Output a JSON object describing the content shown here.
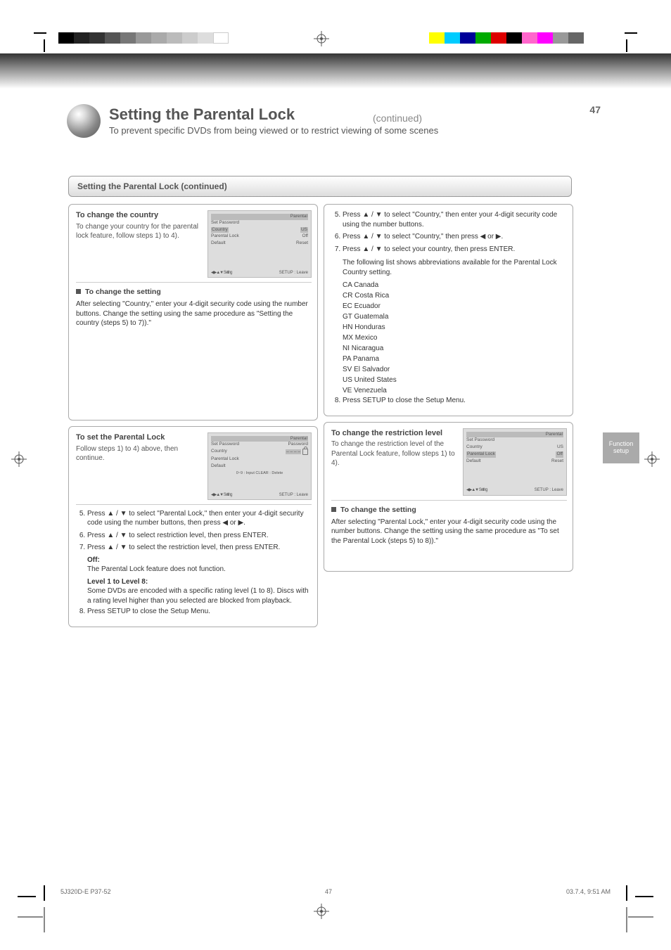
{
  "page_number": "47",
  "header": {
    "title": "Setting the Parental Lock",
    "subtitle": "To prevent specific DVDs from being viewed or to restrict viewing of some scenes",
    "continued": "(continued)"
  },
  "lock_bar": "Setting the Parental Lock (continued)",
  "side_tab": "Function setup",
  "panel_a": {
    "heading": "To change the country",
    "sub": "To change your country for the parental lock feature, follow steps 1) to 4).",
    "screen": {
      "title": "Parental",
      "rows": [
        [
          "Set Password",
          ""
        ],
        [
          "Country",
          "US"
        ],
        [
          "Parental Lock",
          "Off"
        ],
        [
          "Default",
          "Reset"
        ]
      ],
      "nav_left": "◀▶▲▼ Setting",
      "nav_right": "SETUP : Leave"
    },
    "note_title": "To change the setting",
    "note_body": "After selecting \"Country,\" enter your 4-digit security code using the number buttons. Change the setting using the same procedure as \"Setting the country (steps 5) to 7)).\""
  },
  "panel_b": {
    "heading": "To set the Parental Lock",
    "sub": "Follow steps 1) to 4) above, then continue.",
    "screen": {
      "title": "Parental",
      "rows": [
        [
          "Set Password",
          "Password"
        ],
        [
          "Country",
          ""
        ],
        [
          "Parental Lock",
          ""
        ],
        [
          "Default",
          ""
        ]
      ],
      "nav_left": "◀▶▲▼ Setting",
      "nav_right": "SETUP : Leave",
      "status_line": "0~9 : Input  CLEAR : Delete"
    },
    "steps": [
      "Press ▲ / ▼ to select \"Parental Lock,\" then enter your 4-digit security code using the number buttons, then press ◀ or ▶.",
      "Press ▲ / ▼ to select restriction level, then press ENTER.",
      "Press ▲ / ▼ to select the restriction level, then press ENTER."
    ],
    "off_label": "Off:",
    "off_text": "The Parental Lock feature does not function.",
    "level_label": "Level 1 to Level 8:",
    "level_text": "Some DVDs are encoded with a specific rating level (1 to 8). Discs with a rating level higher than you selected are blocked from playback.",
    "step8": "Press SETUP to close the Setup Menu."
  },
  "panel_c": {
    "steps": [
      "Press ▲ / ▼ to select \"Country,\" then enter your 4-digit security code using the number buttons.",
      "Press ▲ / ▼ to select \"Country,\" then press ◀ or ▶.",
      "Press ▲ / ▼ to select your country, then press ENTER."
    ],
    "country_list_intro": "The following list shows abbreviations available for the Parental Lock Country setting.",
    "countries": [
      "CA Canada",
      "CR Costa Rica",
      "EC Ecuador",
      "GT Guatemala",
      "HN Honduras",
      "MX Mexico",
      "NI Nicaragua",
      "PA Panama",
      "SV El Salvador",
      "US United States",
      "VE Venezuela"
    ],
    "step8": "Press SETUP to close the Setup Menu."
  },
  "panel_d": {
    "heading": "To change the restriction level",
    "sub": "To change the restriction level of the Parental Lock feature, follow steps 1) to 4).",
    "screen": {
      "title": "Parental",
      "rows": [
        [
          "Set Password",
          ""
        ],
        [
          "Country",
          "US"
        ],
        [
          "Parental Lock",
          "Off"
        ],
        [
          "Default",
          "Reset"
        ]
      ],
      "nav_left": "◀▶▲▼ Setting",
      "nav_right": "SETUP : Leave"
    },
    "note_title": "To change the setting",
    "note_body": "After selecting \"Parental Lock,\" enter your 4-digit security code using the number buttons. Change the setting using the same procedure as \"To set the Parental Lock (steps 5) to 8)).\""
  },
  "footer": {
    "tag": "5J320D-E  P37-52",
    "page": "47",
    "date": "03.7.4, 9:51 AM"
  }
}
